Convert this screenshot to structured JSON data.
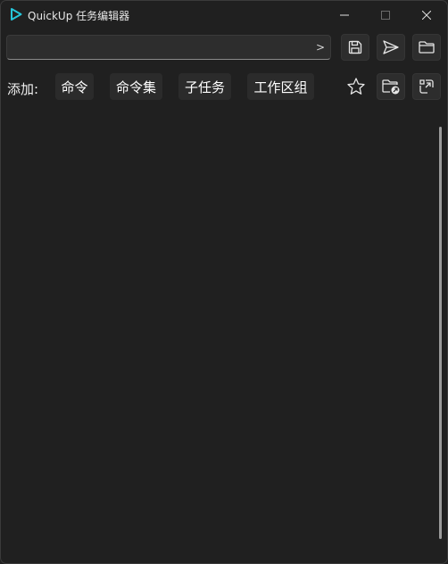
{
  "window": {
    "title": "QuickUp 任务编辑器"
  },
  "command_bar": {
    "input_value": "",
    "run_glyph": ">"
  },
  "add_row": {
    "label": "添加:",
    "buttons": [
      "命令",
      "命令集",
      "子任务",
      "工作区组"
    ]
  },
  "icons": {
    "app": "quickup-play-icon",
    "save": "save-icon",
    "send": "send-icon",
    "open": "folder-icon",
    "favorite": "star-icon",
    "open_location": "folder-shortcut-icon",
    "popout": "popout-icon"
  },
  "colors": {
    "background": "#202020",
    "accent": "#26c6da",
    "button": "#2d2d2d"
  }
}
